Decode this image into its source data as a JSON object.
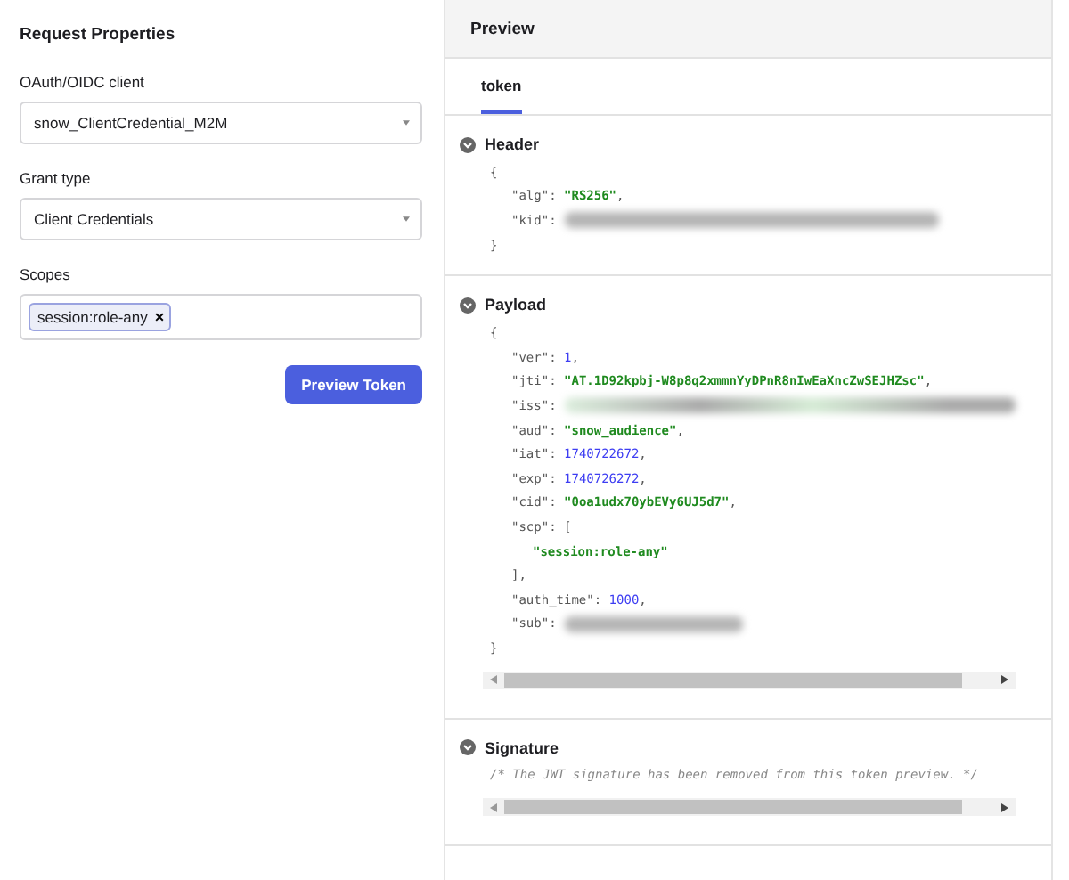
{
  "request_properties": {
    "title": "Request Properties",
    "fields": [
      {
        "kind": "select",
        "label": "OAuth/OIDC client",
        "value": "snow_ClientCredential_M2M"
      },
      {
        "kind": "select",
        "label": "Grant type",
        "value": "Client Credentials"
      },
      {
        "kind": "tags",
        "label": "Scopes",
        "tags": [
          {
            "label": "session:role-any",
            "remove": "×"
          }
        ]
      }
    ],
    "button": "Preview Token"
  },
  "preview": {
    "title": "Preview",
    "tabs": [
      {
        "label": "token",
        "selected": true
      }
    ],
    "sections": [
      {
        "title": "Header",
        "expanded": true,
        "scrollbar": false,
        "lines": [
          {
            "text": "{",
            "children": [
              {
                "key": "\"alg\": ",
                "value": "\"RS256\"",
                "kind": "string",
                "end": ","
              },
              {
                "key": "\"kid\": ",
                "kind": "redacted"
              }
            ]
          },
          {
            "text": "}"
          }
        ]
      },
      {
        "title": "Payload",
        "expanded": true,
        "scrollbar": true,
        "lines": [
          {
            "text": "{",
            "children": [
              {
                "key": "\"ver\": ",
                "value": "1",
                "kind": "number",
                "end": ","
              },
              {
                "key": "\"jti\": ",
                "value": "\"AT.1D92kpbj-W8p8q2xmmnYyDPnR8nIwEaXncZwSEJHZsc\"",
                "kind": "string",
                "end": ","
              },
              {
                "key": "\"iss\": ",
                "kind": "redacted-string"
              },
              {
                "key": "\"aud\": ",
                "value": "\"snow_audience\"",
                "kind": "string",
                "end": ","
              },
              {
                "key": "\"iat\": ",
                "value": "1740722672",
                "kind": "number",
                "end": ","
              },
              {
                "key": "\"exp\": ",
                "value": "1740726272",
                "kind": "number",
                "end": ","
              },
              {
                "key": "\"cid\": ",
                "value": "\"0oa1udx70ybEVy6UJ5d7\"",
                "kind": "string",
                "end": ","
              },
              {
                "key": "\"scp\": ",
                "value": "[",
                "kind": "punct",
                "children": [
                  {
                    "value": "\"session:role-any\"",
                    "kind": "string"
                  }
                ]
              },
              {
                "value": "],",
                "kind": "punct"
              },
              {
                "key": "\"auth_time\": ",
                "value": "1000",
                "kind": "number",
                "end": ","
              },
              {
                "key": "\"sub\": ",
                "kind": "redacted-short"
              }
            ]
          },
          {
            "text": "}"
          }
        ]
      },
      {
        "title": "Signature",
        "expanded": true,
        "scrollbar": true,
        "lines": [
          {
            "value": "/* The JWT signature has been removed from this token preview. */",
            "kind": "comment"
          }
        ]
      }
    ]
  }
}
